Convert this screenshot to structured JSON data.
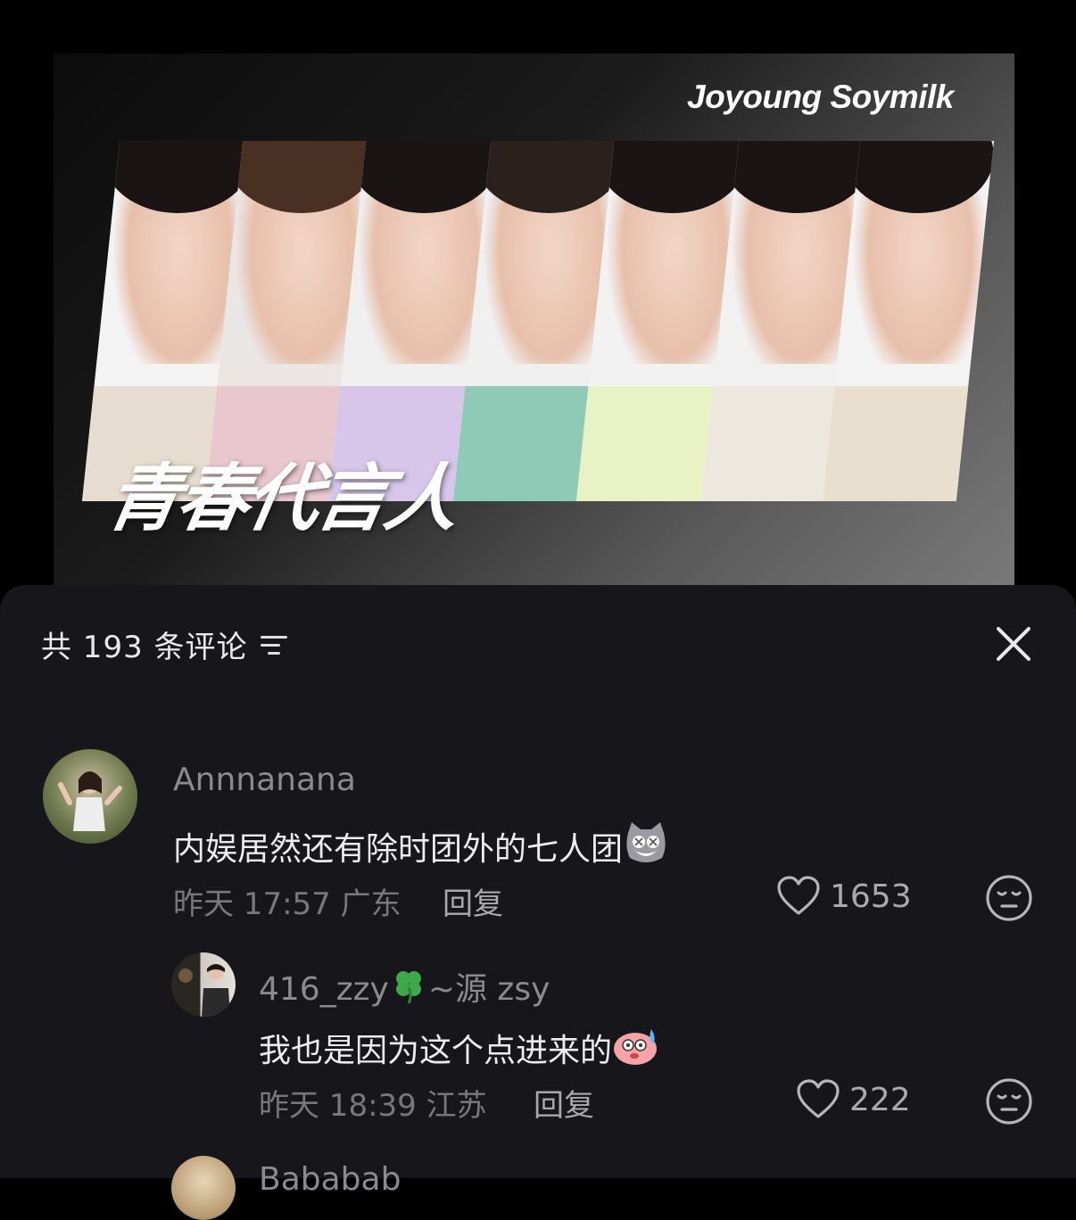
{
  "banner": {
    "brand": "Joyoung Soymilk",
    "slogan": "青春代言人"
  },
  "comments_panel": {
    "title": "共 193 条评论",
    "sort_icon": "sort-lines-icon",
    "close_icon": "close-icon"
  },
  "comments": [
    {
      "username": "Annnanana",
      "text": "内娱居然还有除时团外的七人团",
      "emoji": "cat-dizzy-emoji",
      "time": "昨天 17:57",
      "location": "广东",
      "reply_label": "回复",
      "likes": "1653"
    }
  ],
  "replies": [
    {
      "username_prefix": "416_zzy",
      "username_emoji": "four-leaf-clover-emoji",
      "username_suffix": "~源 zsy",
      "text": "我也是因为这个点进来的",
      "emoji": "sweat-bear-emoji",
      "time": "昨天 18:39",
      "location": "江苏",
      "reply_label": "回复",
      "likes": "222"
    },
    {
      "username": "Bababab"
    }
  ],
  "colors": {
    "panel_bg": "#16161b",
    "text_primary": "#ececee",
    "text_secondary": "#8a8a90"
  }
}
